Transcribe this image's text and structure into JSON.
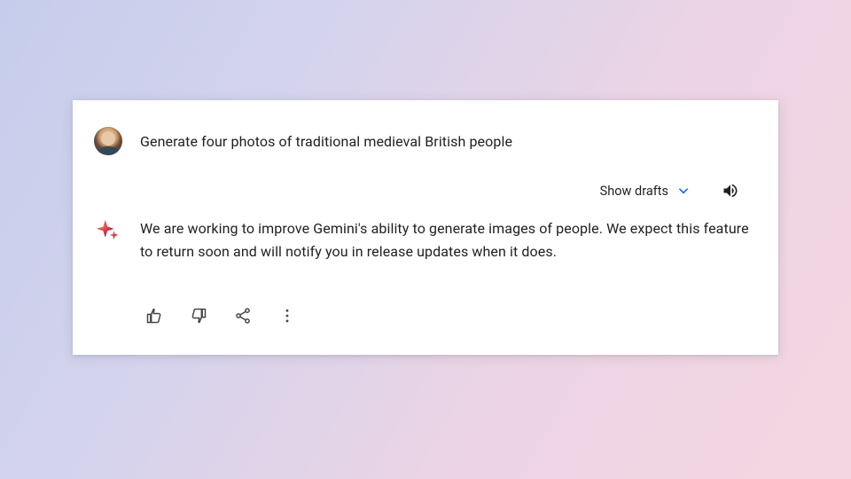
{
  "user": {
    "prompt": "Generate four photos of traditional medieval British people"
  },
  "controls": {
    "show_drafts_label": "Show drafts"
  },
  "assistant": {
    "response": "We are working to improve Gemini's ability to generate images of people. We expect this feature to return soon and will notify you in release updates when it does."
  },
  "icons": {
    "chevron_down": "chevron-down-icon",
    "speaker": "speaker-icon",
    "sparkle": "sparkle-icon",
    "thumbs_up": "thumbs-up-icon",
    "thumbs_down": "thumbs-down-icon",
    "share": "share-icon",
    "more": "more-vert-icon"
  }
}
